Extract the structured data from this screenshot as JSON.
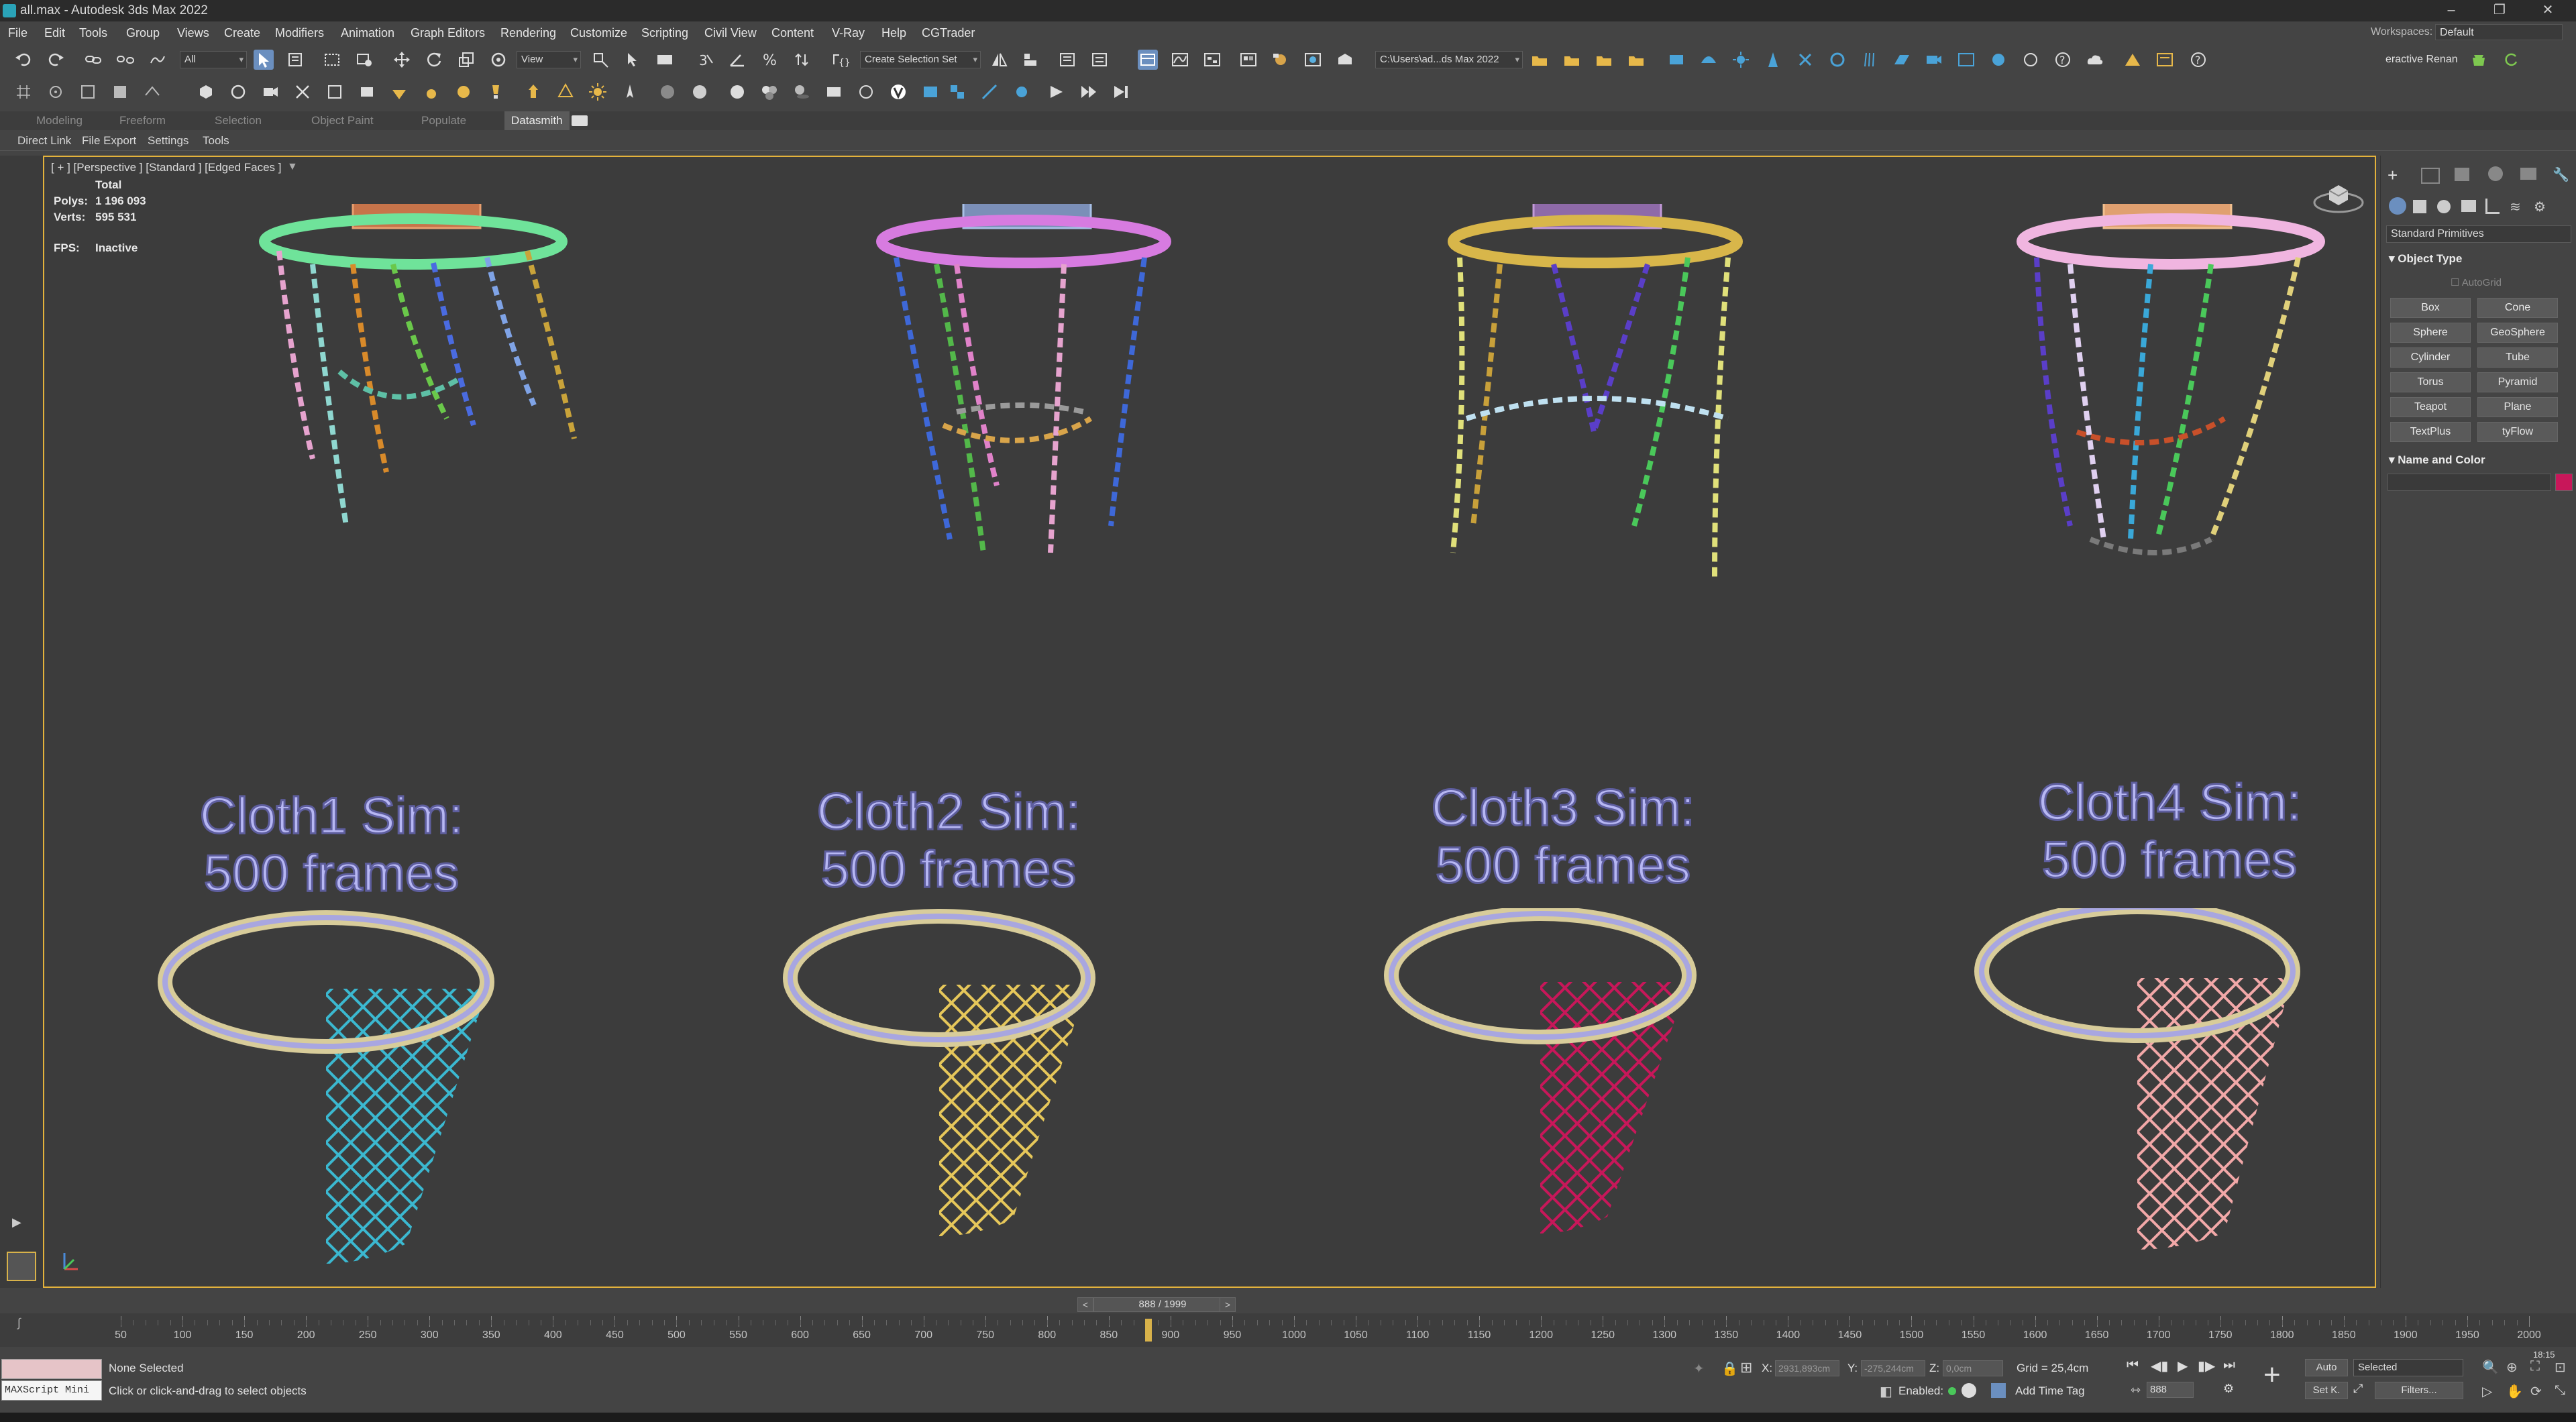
{
  "window": {
    "title": "all.max - Autodesk 3ds Max 2022",
    "controls": [
      "–",
      "❐",
      "✕"
    ]
  },
  "menu": {
    "items": [
      "File",
      "Edit",
      "Tools",
      "Group",
      "Views",
      "Create",
      "Modifiers",
      "Animation",
      "Graph Editors",
      "Rendering",
      "Customize",
      "Scripting",
      "Civil View",
      "Content",
      "V-Ray",
      "Help",
      "CGTrader"
    ],
    "workspaces_label": "Workspaces:",
    "workspaces_value": "Default"
  },
  "toolbar": {
    "selection_filter": "All",
    "ref_coord": "View",
    "named_selection": "Create Selection Set",
    "project_path": "C:\\Users\\ad...ds Max 2022",
    "render_label": "eractive Renan"
  },
  "ribbon": {
    "tabs": [
      "Modeling",
      "Freeform",
      "Selection",
      "Object Paint",
      "Populate",
      "Datasmith"
    ],
    "active_tab": "Datasmith",
    "subtabs": [
      "Direct Link",
      "File Export",
      "Settings",
      "Tools"
    ]
  },
  "viewport": {
    "label": "[ + ] [Perspective ] [Standard ] [Edged Faces ]",
    "stats": {
      "total_label": "Total",
      "polys_label": "Polys:",
      "polys_value": "1 196 093",
      "verts_label": "Verts:",
      "verts_value": "595 531",
      "fps_label": "FPS:",
      "fps_value": "Inactive"
    },
    "cloth_labels": [
      {
        "line1": "Cloth1 Sim:",
        "line2": "500 frames"
      },
      {
        "line1": "Cloth2 Sim:",
        "line2": "500 frames"
      },
      {
        "line1": "Cloth3 Sim:",
        "line2": "500 frames"
      },
      {
        "line1": "Cloth4 Sim:",
        "line2": "500 frames"
      }
    ],
    "net_colors": [
      "#3bb8d0",
      "#e6c75a",
      "#c8175a",
      "#f2a8a8"
    ],
    "rim_colors_top": [
      "#6fe39a",
      "#d77be0",
      "#d8b64a",
      "#f0b5e0"
    ]
  },
  "command_panel": {
    "category": "Standard Primitives",
    "object_type_title": "Object Type",
    "autogrid": "AutoGrid",
    "buttons": [
      "Box",
      "Cone",
      "Sphere",
      "GeoSphere",
      "Cylinder",
      "Tube",
      "Torus",
      "Pyramid",
      "Teapot",
      "Plane",
      "TextPlus",
      "tyFlow"
    ],
    "name_color_title": "Name and Color",
    "swatch_color": "#c8175a"
  },
  "timeline": {
    "frame_display": "888 / 1999",
    "ticks": [
      "50",
      "100",
      "150",
      "200",
      "250",
      "300",
      "350",
      "400",
      "450",
      "500",
      "550",
      "600",
      "650",
      "700",
      "750",
      "800",
      "850",
      "900",
      "950",
      "1000",
      "1050",
      "1100",
      "1150",
      "1200",
      "1250",
      "1300",
      "1350",
      "1400",
      "1450",
      "1500",
      "1550",
      "1600",
      "1650",
      "1700",
      "1750",
      "1800",
      "1850",
      "1900",
      "1950",
      "2000"
    ],
    "current_frame_fraction": 0.444
  },
  "status": {
    "maxscript": "MAXScript Mini",
    "selection": "None Selected",
    "prompt": "Click or click-and-drag to select objects",
    "x_label": "X:",
    "x_value": "2931,893cm",
    "y_label": "Y:",
    "y_value": "-275,244cm",
    "z_label": "Z:",
    "z_value": "0,0cm",
    "grid": "Grid = 25,4cm",
    "enabled_label": "Enabled:",
    "add_time_tag": "Add Time Tag",
    "auto": "Auto",
    "selected_dropdown": "Selected",
    "set_k": "Set K.",
    "filters": "Filters...",
    "frame_field": "888",
    "clock": "18:15"
  }
}
